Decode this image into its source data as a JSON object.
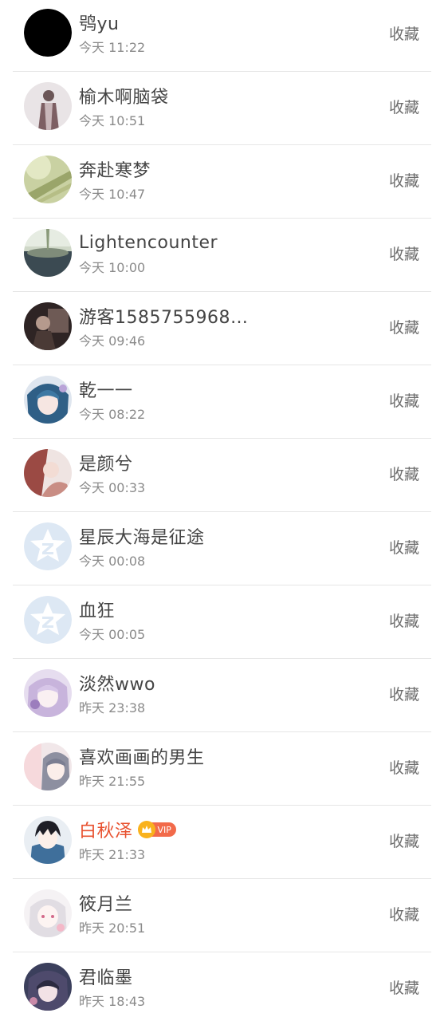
{
  "visitors": [
    {
      "name": "鸮yu",
      "time": "今天 11:22",
      "action": "收藏",
      "avatar": "black-avatar",
      "vip": false
    },
    {
      "name": "榆木啊脑袋",
      "time": "今天 10:51",
      "action": "收藏",
      "avatar": "photo-avatar",
      "vip": false
    },
    {
      "name": "奔赴寒梦",
      "time": "今天 10:47",
      "action": "收藏",
      "avatar": "photo-avatar",
      "vip": false
    },
    {
      "name": "Lightencounter",
      "time": "今天 10:00",
      "action": "收藏",
      "avatar": "photo-avatar",
      "vip": false
    },
    {
      "name": "游客1585755968…",
      "time": "今天 09:46",
      "action": "收藏",
      "avatar": "photo-avatar",
      "vip": false
    },
    {
      "name": "乾一一",
      "time": "今天 08:22",
      "action": "收藏",
      "avatar": "anime-avatar",
      "vip": false
    },
    {
      "name": "是颜兮",
      "time": "今天 00:33",
      "action": "收藏",
      "avatar": "photo-avatar",
      "vip": false
    },
    {
      "name": "星辰大海是征途",
      "time": "今天 00:08",
      "action": "收藏",
      "avatar": "default-star-avatar",
      "vip": false
    },
    {
      "name": "血狂",
      "time": "今天 00:05",
      "action": "收藏",
      "avatar": "default-star-avatar",
      "vip": false
    },
    {
      "name": "淡然wwo",
      "time": "昨天 23:38",
      "action": "收藏",
      "avatar": "anime-avatar",
      "vip": false
    },
    {
      "name": "喜欢画画的男生",
      "time": "昨天 21:55",
      "action": "收藏",
      "avatar": "anime-avatar",
      "vip": false
    },
    {
      "name": "白秋泽",
      "time": "昨天 21:33",
      "action": "收藏",
      "avatar": "anime-avatar",
      "vip": true,
      "vip_label": "VIP"
    },
    {
      "name": "筱月兰",
      "time": "昨天 20:51",
      "action": "收藏",
      "avatar": "anime-avatar",
      "vip": false
    },
    {
      "name": "君临墨",
      "time": "昨天 18:43",
      "action": "收藏",
      "avatar": "anime-avatar",
      "vip": false
    }
  ],
  "colors": {
    "name": "#444444",
    "vip_name": "#e8512f",
    "time": "#8a8a8a",
    "action": "#6d6d6d",
    "divider": "#e6e6e6",
    "vip_badge": "#f26a4a",
    "vip_crown": "#f9b21d"
  }
}
